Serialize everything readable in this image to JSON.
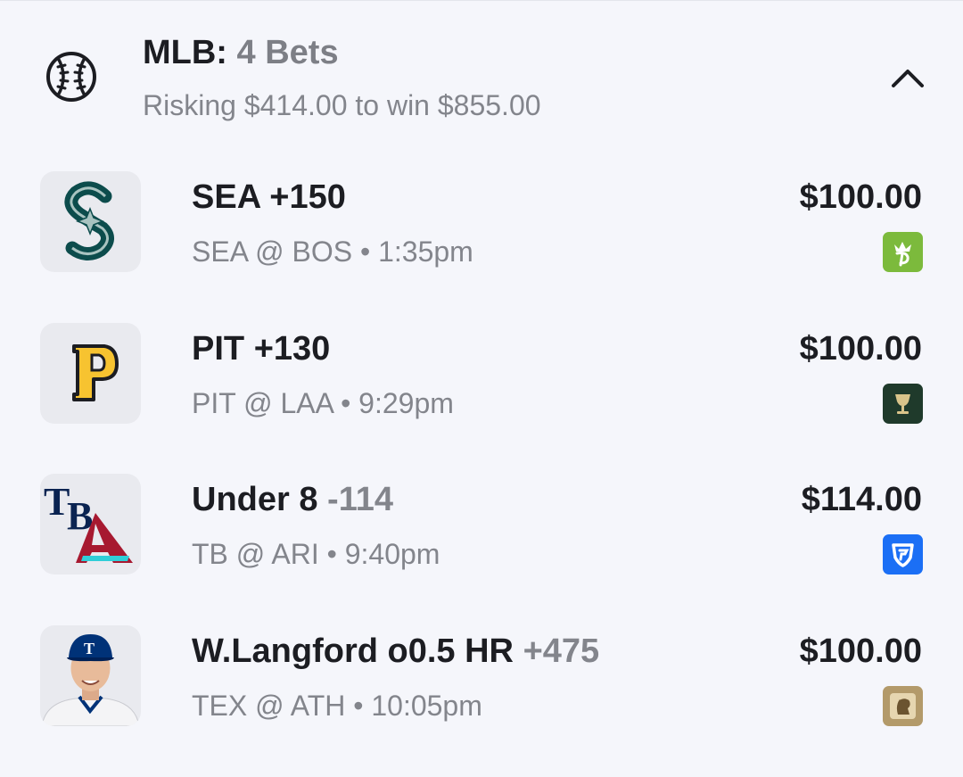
{
  "section": {
    "league": "MLB:",
    "count": "4 Bets",
    "summary": "Risking $414.00 to win $855.00",
    "icon": "baseball-icon",
    "toggle_icon": "chevron-up-icon"
  },
  "bets": [
    {
      "pick": "SEA",
      "odds": "+150",
      "game": "SEA @ BOS • 1:35pm",
      "stake": "$100.00",
      "team_logo": "seattle-mariners-logo",
      "book": "draftkings-icon",
      "book_color": "#7cba3c"
    },
    {
      "pick": "PIT",
      "odds": "+130",
      "game": "PIT @ LAA • 9:29pm",
      "stake": "$100.00",
      "team_logo": "pittsburgh-pirates-logo",
      "book": "bet365-cup-icon",
      "book_color": "#1f3a2b"
    },
    {
      "pick": "Under 8",
      "odds": "-114",
      "game": "TB @ ARI • 9:40pm",
      "stake": "$114.00",
      "team_logo": "tampa-bay-arizona-logos",
      "book": "fanduel-icon",
      "book_color": "#1b6ff5"
    },
    {
      "pick": "W.Langford o0.5 HR",
      "odds": "+475",
      "game": "TEX @ ATH • 10:05pm",
      "stake": "$100.00",
      "team_logo": "player-headshot",
      "book": "caesars-icon",
      "book_color": "#b39a6a"
    }
  ]
}
